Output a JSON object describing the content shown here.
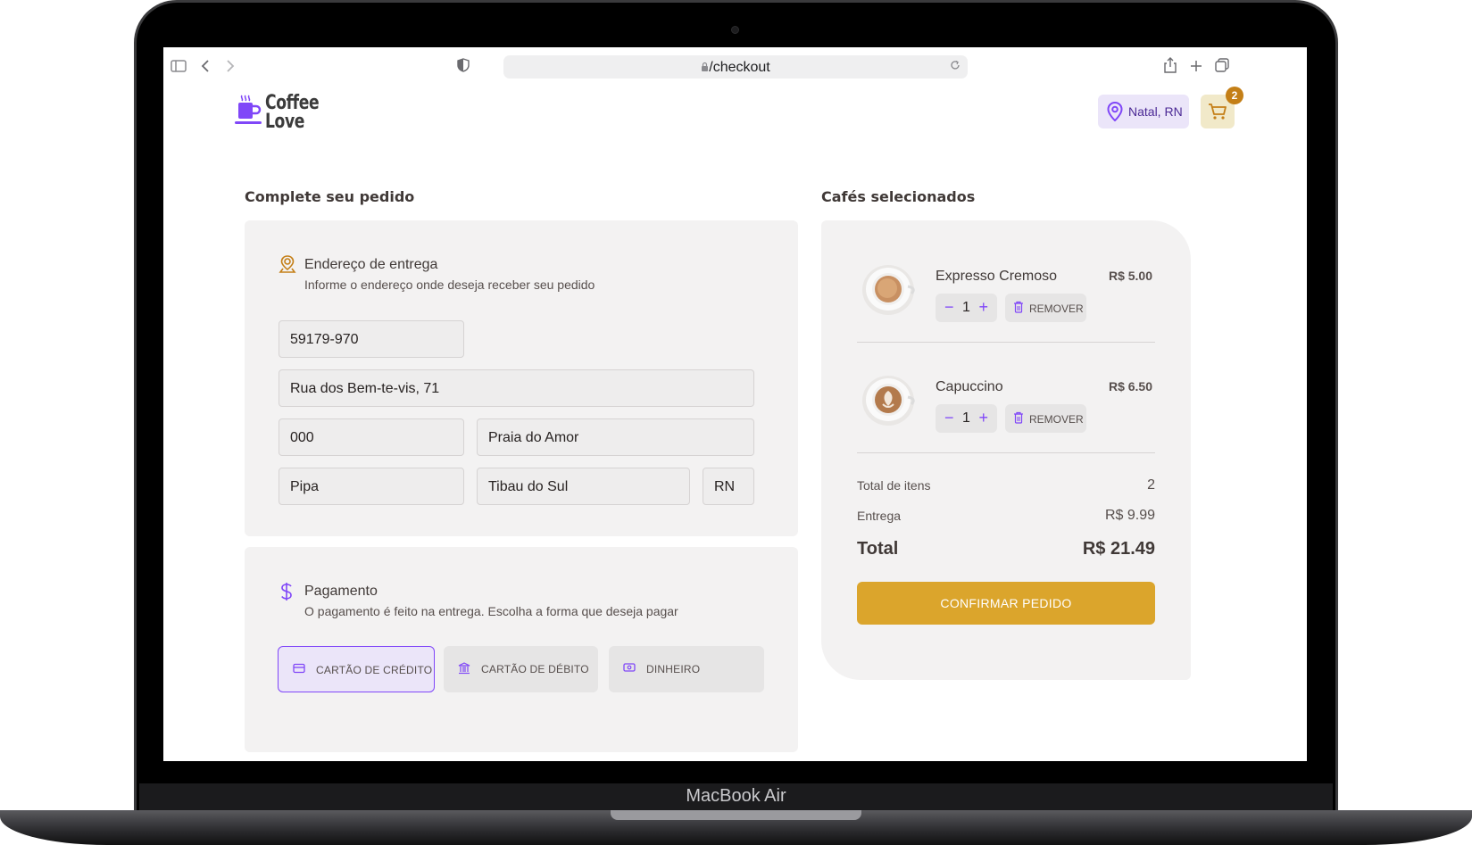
{
  "device": {
    "brand_label": "MacBook Air"
  },
  "browser": {
    "url": "/checkout"
  },
  "header": {
    "logo_line1": "Coffee",
    "logo_line2": "Love",
    "location": "Natal, RN",
    "cart_count": "2"
  },
  "checkout": {
    "title": "Complete seu pedido",
    "address": {
      "title": "Endereço de entrega",
      "subtitle": "Informe o endereço onde deseja receber seu pedido",
      "cep": "59179-970",
      "street": "Rua dos Bem-te-vis, 71",
      "number": "000",
      "neighborhood": "Praia do Amor",
      "district": "Pipa",
      "city": "Tibau do Sul",
      "uf": "RN"
    },
    "payment": {
      "title": "Pagamento",
      "subtitle": "O pagamento é feito na entrega. Escolha a forma que deseja pagar",
      "options": [
        "CARTÃO DE CRÉDITO",
        "CARTÃO DE DÉBITO",
        "DINHEIRO"
      ],
      "selected": "CARTÃO DE CRÉDITO"
    }
  },
  "cart": {
    "title": "Cafés selecionados",
    "items": [
      {
        "name": "Expresso Cremoso",
        "price": "R$ 5.00",
        "qty": "1",
        "remove_label": "REMOVER"
      },
      {
        "name": "Capuccino",
        "price": "R$ 6.50",
        "qty": "1",
        "remove_label": "REMOVER"
      }
    ],
    "stepper_minus": "−",
    "stepper_plus": "+",
    "summary": {
      "items_label": "Total de itens",
      "items_value": "2",
      "delivery_label": "Entrega",
      "delivery_value": "R$ 9.99",
      "total_label": "Total",
      "total_value": "R$ 21.49"
    },
    "confirm_label": "CONFIRMAR PEDIDO"
  },
  "colors": {
    "purple": "#8047f8",
    "purple_dark": "#4b2995",
    "purple_light": "#ebe5f9",
    "yellow": "#dba52c",
    "yellow_dark": "#c47f17",
    "yellow_light": "#f1e9c9",
    "card_bg": "#f3f2f2"
  },
  "icons": [
    "sidebar-icon",
    "back-icon",
    "forward-icon",
    "shield-icon",
    "lock-icon",
    "reload-icon",
    "share-icon",
    "new-tab-icon",
    "tabs-icon",
    "map-pin-icon",
    "cart-icon",
    "dollar-icon",
    "credit-card-icon",
    "bank-icon",
    "money-icon",
    "trash-icon"
  ]
}
